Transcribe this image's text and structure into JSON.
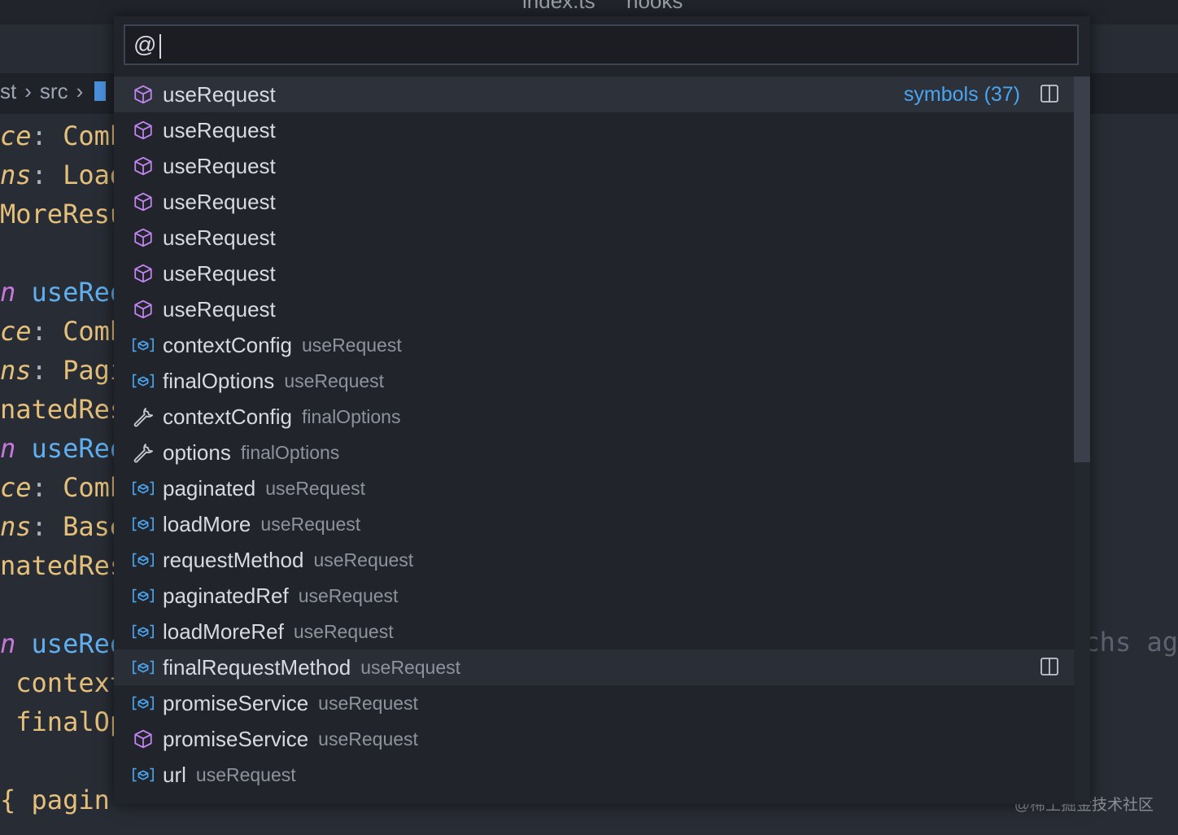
{
  "tabs": [
    "index.ts",
    "hooks"
  ],
  "breadcrumb": [
    "st",
    "src"
  ],
  "code_lines": [
    {
      "left": "ce",
      "sep": ": ",
      "right": "Comb"
    },
    {
      "left": "ns",
      "sep": ": ",
      "right": "Load"
    },
    {
      "text": "MoreResu"
    },
    {
      "text": ""
    },
    {
      "kw": "n ",
      "fn": "useReq"
    },
    {
      "left": "ce",
      "sep": ": ",
      "right": "Comb"
    },
    {
      "left": "ns",
      "sep": ": ",
      "right": "Pagi"
    },
    {
      "text": "natedRes"
    },
    {
      "kw": "n ",
      "fn": "useReq"
    },
    {
      "left": "ce",
      "sep": ": ",
      "right": "Comb"
    },
    {
      "left": "ns",
      "sep": ": ",
      "right": "Base"
    },
    {
      "text": "natedRes"
    },
    {
      "text": ""
    },
    {
      "kw": "n ",
      "fn": "useReq"
    },
    {
      "plain": " context"
    },
    {
      "plain": " finalOp"
    },
    {
      "text": ""
    },
    {
      "plain": "{ pagin"
    }
  ],
  "right_ghost": "chs ag",
  "watermark": "@稀土掘金技术社区",
  "quick_pick": {
    "input_value": "@",
    "kind_label": "symbols (37)",
    "items": [
      {
        "icon": "cube-icon",
        "label": "useRequest",
        "desc": ""
      },
      {
        "icon": "cube-icon",
        "label": "useRequest",
        "desc": ""
      },
      {
        "icon": "cube-icon",
        "label": "useRequest",
        "desc": ""
      },
      {
        "icon": "cube-icon",
        "label": "useRequest",
        "desc": ""
      },
      {
        "icon": "cube-icon",
        "label": "useRequest",
        "desc": ""
      },
      {
        "icon": "cube-icon",
        "label": "useRequest",
        "desc": ""
      },
      {
        "icon": "cube-icon",
        "label": "useRequest",
        "desc": ""
      },
      {
        "icon": "variable-icon",
        "label": "contextConfig",
        "desc": "useRequest"
      },
      {
        "icon": "variable-icon",
        "label": "finalOptions",
        "desc": "useRequest"
      },
      {
        "icon": "wrench-icon",
        "label": "contextConfig",
        "desc": "finalOptions"
      },
      {
        "icon": "wrench-icon",
        "label": "options",
        "desc": "finalOptions"
      },
      {
        "icon": "variable-icon",
        "label": "paginated",
        "desc": "useRequest"
      },
      {
        "icon": "variable-icon",
        "label": "loadMore",
        "desc": "useRequest"
      },
      {
        "icon": "variable-icon",
        "label": "requestMethod",
        "desc": "useRequest"
      },
      {
        "icon": "variable-icon",
        "label": "paginatedRef",
        "desc": "useRequest"
      },
      {
        "icon": "variable-icon",
        "label": "loadMoreRef",
        "desc": "useRequest"
      },
      {
        "icon": "variable-icon",
        "label": "finalRequestMethod",
        "desc": "useRequest"
      },
      {
        "icon": "variable-icon",
        "label": "promiseService",
        "desc": "useRequest"
      },
      {
        "icon": "cube-icon",
        "label": "promiseService",
        "desc": "useRequest"
      },
      {
        "icon": "variable-icon",
        "label": "url",
        "desc": "useRequest"
      }
    ]
  },
  "colors": {
    "cube": "#c586f5",
    "variable": "#4aa5f0",
    "wrench": "#c5c8ce",
    "kind_label": "#4aa5f0"
  }
}
